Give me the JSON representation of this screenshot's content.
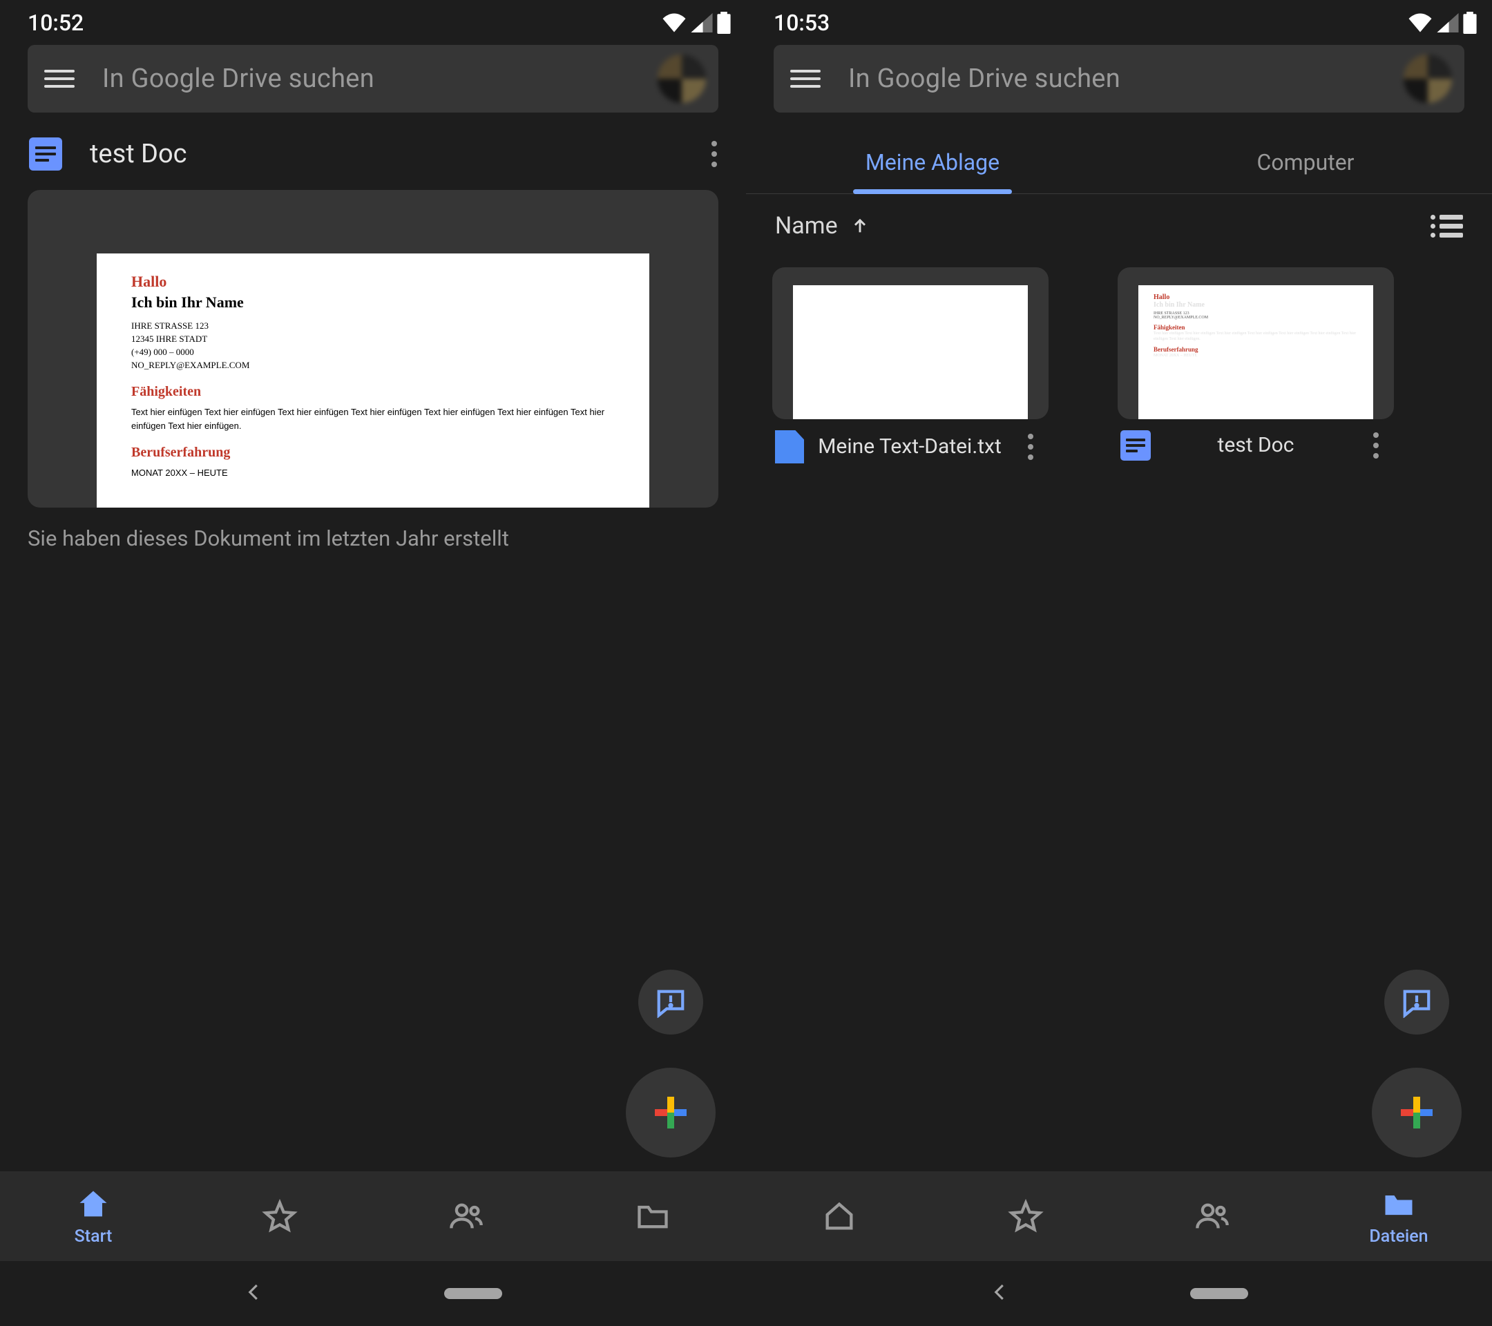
{
  "colors": {
    "accent": "#7aa7ff"
  },
  "left": {
    "status_time": "10:52",
    "search_placeholder": "In Google Drive suchen",
    "suggestion": {
      "title": "test Doc",
      "caption": "Sie haben dieses Dokument im letzten Jahr erstellt",
      "preview": {
        "greeting": "Hallo",
        "subtitle": "Ich bin Ihr Name",
        "addr1": "IHRE STRASSE 123",
        "addr2": "12345 IHRE STADT",
        "phone": "(+49) 000 – 0000",
        "email": "NO_REPLY@EXAMPLE.COM",
        "sec1": "Fähigkeiten",
        "body1": "Text hier einfügen Text hier einfügen Text hier einfügen Text hier einfügen Text hier einfügen Text hier einfügen Text hier einfügen Text hier einfügen.",
        "sec2": "Berufserfahrung",
        "body2": "MONAT 20XX – HEUTE"
      }
    },
    "nav": {
      "start": "Start",
      "star": "",
      "shared": "",
      "files": ""
    }
  },
  "right": {
    "status_time": "10:53",
    "search_placeholder": "In Google Drive suchen",
    "tabs": {
      "mydrive": "Meine Ablage",
      "computer": "Computer"
    },
    "sort_label": "Name",
    "files": [
      {
        "name": "Meine Text-Datei.txt",
        "type": "txt"
      },
      {
        "name": "test Doc",
        "type": "doc"
      }
    ],
    "nav": {
      "files": "Dateien"
    }
  }
}
